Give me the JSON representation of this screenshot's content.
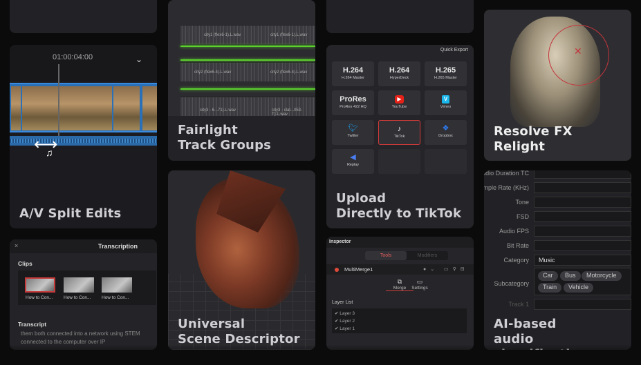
{
  "av": {
    "timecode": "01:00:04:00",
    "title_line1": "A/V Split Edits"
  },
  "fairlight": {
    "title_line1": "Fairlight",
    "title_line2": "Track Groups",
    "clip_labels": [
      "city1 (flex6-1).L.wav",
      "city1 (flex6-1).L.wav",
      "city2 (flex6-4).L.wav",
      "city2 (flex6-4).L.wav",
      "city3 - 6...71).L.wav",
      "city3 - clat...053-T).L.wav"
    ]
  },
  "upload": {
    "panel_title": "Quick Export",
    "tiles": [
      {
        "big": "H.264",
        "small": "H.264 Master"
      },
      {
        "big": "H.264",
        "small": "HyperDeck"
      },
      {
        "big": "H.265",
        "small": "H.265 Master"
      },
      {
        "big": "ProRes",
        "small": "ProRes 422 HQ"
      },
      {
        "icon": "▶",
        "small": "YouTube"
      },
      {
        "icon": "V",
        "small": "Vimeo"
      },
      {
        "icon": "🐦",
        "small": "Twitter"
      },
      {
        "icon": "♪",
        "small": "TikTok"
      },
      {
        "icon": "❖",
        "small": "Dropbox"
      },
      {
        "icon": "◀",
        "small": "Replay"
      }
    ],
    "title_line1": "Upload",
    "title_line2": "Directly to TikTok"
  },
  "relight": {
    "title_line1": "Resolve FX",
    "title_line2": "Relight"
  },
  "transcription": {
    "header": "Transcription",
    "close": "×",
    "clips_label": "Clips",
    "clips": [
      "How to Con...",
      "How to Con...",
      "How to Con..."
    ],
    "transcript_label": "Transcript",
    "transcript_text": "them both connected into a network using STEM connected to the computer over IP"
  },
  "usd": {
    "title_line1": "Universal",
    "title_line2": "Scene Descriptor"
  },
  "inspector": {
    "header": "Inspector",
    "seg_tools": "Tools",
    "seg_modifiers": "Modifiers",
    "node_name": "MultiMerge1",
    "tab_merge": "Merge",
    "tab_settings": "Settings",
    "layer_list_label": "Layer List",
    "layers": [
      "Layer 3",
      "Layer 2",
      "Layer 1"
    ]
  },
  "audio_class": {
    "rows": [
      {
        "key": "Audio Duration TC",
        "value": ""
      },
      {
        "key": "Sample Rate (KHz)",
        "value": ""
      },
      {
        "key": "Tone",
        "value": ""
      },
      {
        "key": "FSD",
        "value": ""
      },
      {
        "key": "Audio FPS",
        "value": ""
      },
      {
        "key": "Bit Rate",
        "value": ""
      },
      {
        "key": "Category",
        "value": "Music"
      }
    ],
    "subcategory_label": "Subcategory",
    "chips": [
      "Car",
      "Bus",
      "Motorcycle",
      "Train",
      "Vehicle"
    ],
    "track_label": "Track 1",
    "title_line1": "AI-based",
    "title_line2": "audio classification"
  },
  "colors": {
    "accent_red": "#d23a3a",
    "fairlight_green": "#5cd12e",
    "timeline_blue": "#2a70b8"
  }
}
